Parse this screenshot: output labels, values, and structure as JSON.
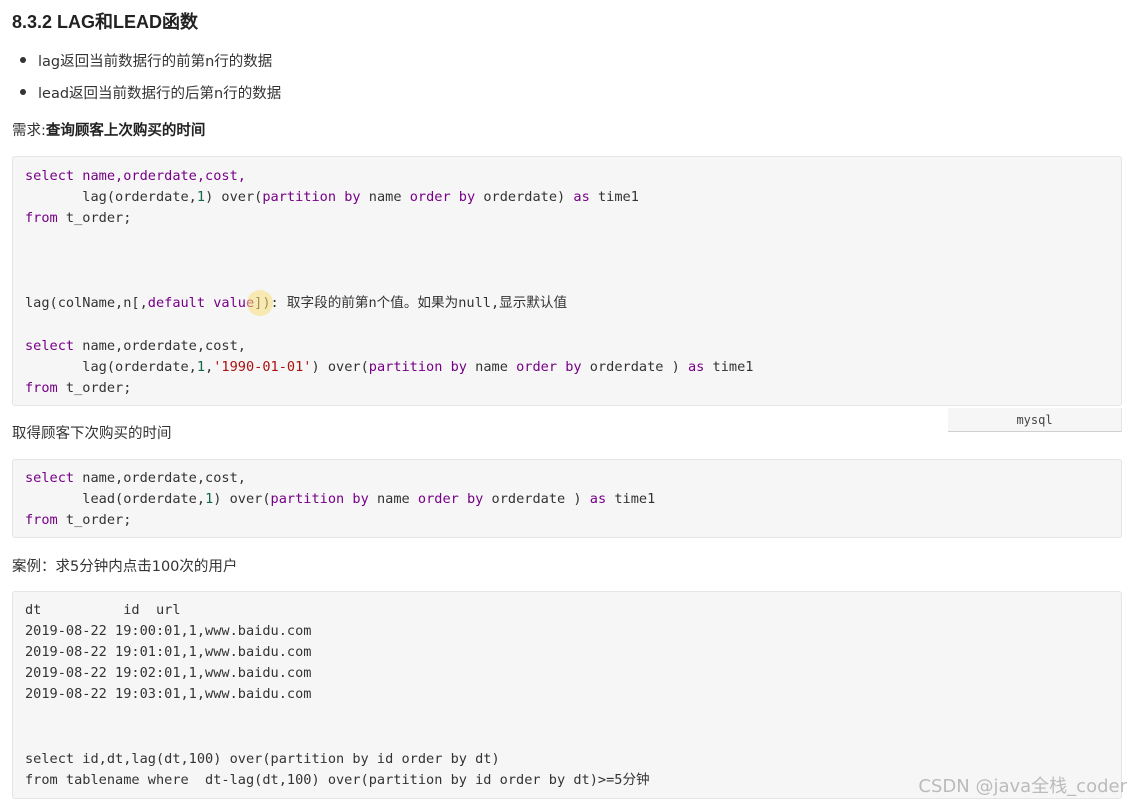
{
  "heading": "8.3.2  LAG和LEAD函数",
  "bullets": [
    "lag返回当前数据行的前第n行的数据",
    "lead返回当前数据行的后第n行的数据"
  ],
  "need1": {
    "prefix": "需求:",
    "bold": "查询顾客上次购买的时间"
  },
  "block1": {
    "l1a": "select name,orderdate,cost,",
    "l2_lag": "       lag(orderdate,",
    "l2_one": "1",
    "l2_over": ") over(",
    "l2_partition": "partition",
    "l2_by1": " by",
    "l2_name": " name ",
    "l2_order": "order",
    "l2_by2": " by",
    "l2_orderdate": " orderdate) ",
    "l2_as": "as",
    "l2_time1": " time1",
    "l3_from": "from",
    "l3_rest": " t_order;",
    "l4_lag": "lag(colName,n[,",
    "l4_default": "default",
    "l4_sp": " ",
    "l4_value": "value",
    "l4_rest": "]): 取字段的前第n个值。如果为null,显示默认值",
    "l5_select": "select",
    "l5_rest": " name,orderdate,cost,",
    "l6_lag": "       lag(orderdate,",
    "l6_one": "1",
    "l6_comma": ",",
    "l6_str": "'1990-01-01'",
    "l6_over": ") over(",
    "l6_partition": "partition",
    "l6_by1": " by",
    "l6_name": " name ",
    "l6_order": "order",
    "l6_by2": " by",
    "l6_orderdate": " orderdate ) ",
    "l6_as": "as",
    "l6_time1": " time1",
    "l7_from": "from",
    "l7_rest": " t_order;"
  },
  "lang_label": "mysql",
  "need2": "取得顾客下次购买的时间",
  "block2": {
    "l1_select": "select",
    "l1_rest": " name,orderdate,cost,",
    "l2_lead": "       lead(orderdate,",
    "l2_one": "1",
    "l2_over": ") over(",
    "l2_partition": "partition",
    "l2_by1": " by",
    "l2_name": " name ",
    "l2_order": "order",
    "l2_by2": " by",
    "l2_orderdate": " orderdate ) ",
    "l2_as": "as",
    "l2_time1": " time1",
    "l3_from": "from",
    "l3_rest": " t_order;"
  },
  "case": "案例：求5分钟内点击100次的用户",
  "block3": {
    "lines": [
      "dt          id  url",
      "2019-08-22 19:00:01,1,www.baidu.com",
      "2019-08-22 19:01:01,1,www.baidu.com",
      "2019-08-22 19:02:01,1,www.baidu.com",
      "2019-08-22 19:03:01,1,www.baidu.com",
      "select id,dt,lag(dt,100) over(partition by id order by dt)",
      "from tablename where  dt-lag(dt,100) over(partition by id order by dt)>=5分钟"
    ]
  },
  "watermark": "CSDN @java全栈_coder"
}
